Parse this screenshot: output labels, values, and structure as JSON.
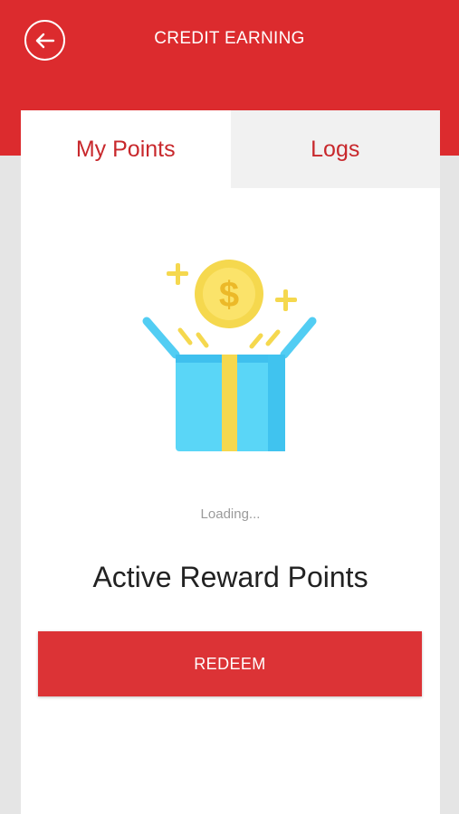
{
  "header": {
    "title": "CREDIT EARNING",
    "back_icon": "arrow-left-circle-icon",
    "background_color": "#dc2b2e"
  },
  "tabs": [
    {
      "label": "My Points",
      "active": true
    },
    {
      "label": "Logs",
      "active": false
    }
  ],
  "illustration": {
    "icon": "gift-box-coin-icon",
    "coin_symbol": "$"
  },
  "status": {
    "loading_text": "Loading..."
  },
  "points": {
    "label": "Active Reward Points"
  },
  "actions": {
    "redeem_label": "REDEEM",
    "accent_color": "#dc3336"
  }
}
